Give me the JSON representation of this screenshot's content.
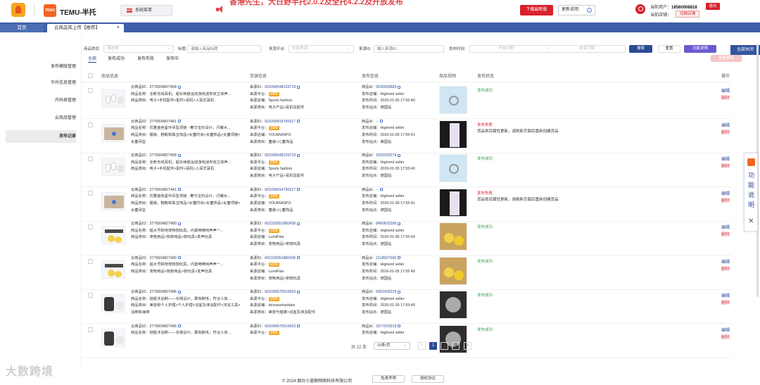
{
  "header": {
    "brand": "TEMU-半托",
    "sys_menu": "系统菜单",
    "announcement": "香港先生，大日野半托2.0.2及全托4.2.2及开放发布",
    "btn_download": "下载最新版",
    "btn_update": "更新说明",
    "user_label": "当前用户：",
    "user_phone": "18560008818",
    "store_label": "当前店铺：",
    "btn_logout": "退出",
    "btn_switch": "切换店铺"
  },
  "tabs": {
    "home": "首页",
    "active": "云商品库上传【推荐】",
    "close_icon": "×",
    "close_all": "全部关闭"
  },
  "sidebar": {
    "items": [
      "发布模版管理",
      "半托信息管理",
      "尺码表管理",
      "云商品管理",
      "发布记录"
    ],
    "active_index": 4
  },
  "filters": {
    "category_label": "商品类目",
    "category_placeholder": "请选择",
    "title_label": "标题",
    "title_placeholder": "请输入商品标题",
    "platform_label": "来源平台",
    "platform_placeholder": "全部来源",
    "source_id_label": "来源ID",
    "source_id_placeholder": "输入来源ID",
    "time_label": "发布时间",
    "start_placeholder": "开始日期",
    "dash": "-",
    "end_placeholder": "结束日期",
    "btn_search": "搜索",
    "btn_reset": "重置",
    "btn_help": "功能说明",
    "btn_batch_delete": "批量删除"
  },
  "status_tabs": [
    "全部",
    "发布成功",
    "发布失败",
    "发布中"
  ],
  "columns": [
    "商品信息",
    "货源信息",
    "发布信息",
    "商品视频",
    "发布状态",
    "操作"
  ],
  "rows": [
    {
      "cloud_id": "云商品ID：2776504827458",
      "name": "商品名称：全新无线耳机，超长续航运动游戏迷你双立体声...",
      "cat": "商品类目：电子>手机配件>配件>耳机>入耳式耳机",
      "src_id": "601099548120716",
      "src_platform": "来源平台：",
      "src_shop": "来源店铺：Sports fashion",
      "src_cat": "来源类目：电子产品>耳机及配件",
      "pub_id": "9536930683",
      "pub_shop": "发布店铺：Highend seller",
      "pub_time": "发布时间：2026-01-05 17:55:40",
      "pub_site": "发布站点：德国站",
      "status": "发布成功",
      "status_type": "ok",
      "msg": "",
      "thumb": "earbuds",
      "video": "light"
    },
    {
      "cloud_id": "云商品ID：2776504827441",
      "name": "商品名称：优雅蓝色星环吊坠项链 - 奢华宝石设计，闪耀水...",
      "cat": "商品类目：服装、鞋靴和珠宝饰品>女童时尚>女童饰品>女童项链>女童吊坠",
      "src_id": "601099914790117",
      "src_platform": "来源平台：",
      "src_shop": "来源店铺：YOUMIASPO",
      "src_cat": "来源类目：童装>儿童饰品",
      "pub_id": "--",
      "pub_shop": "发布店铺：Highend seller",
      "pub_time": "发布时间：2026-01-05 17:55:41",
      "pub_site": "发布站点：美国站",
      "status": "发布失败",
      "status_type": "fail",
      "msg": "货品类目属性更新，请刷新页面后重新创建货品",
      "thumb": "necklace",
      "video": "dark"
    },
    {
      "cloud_id": "云商品ID：2776504827458",
      "name": "商品名称：全新无线耳机，超长续航运动游戏迷你双立体声...",
      "cat": "商品类目：电子>手机配件>配件>耳机>入耳式耳机",
      "src_id": "601099548120716",
      "src_platform": "来源平台：",
      "src_shop": "来源店铺：Sports fashion",
      "src_cat": "来源类目：电子产品>耳机及配件",
      "pub_id": "1591930274",
      "pub_shop": "发布店铺：Highend seller",
      "pub_time": "发布时间：2026-01-05 17:55:40",
      "pub_site": "发布站点：德国站",
      "status": "发布成功",
      "status_type": "ok",
      "msg": "",
      "thumb": "earbuds",
      "video": "light"
    },
    {
      "cloud_id": "云商品ID：2776504827441",
      "name": "商品名称：优雅蓝色星环吊坠项链 - 奢华宝石设计，闪耀水...",
      "cat": "商品类目：服装、鞋靴和珠宝饰品>女童时尚>女童饰品>女童项链>女童吊坠",
      "src_id": "601099914790117",
      "src_platform": "来源平台：",
      "src_shop": "来源店铺：YOUMIASPO",
      "src_cat": "来源类目：童装>儿童饰品",
      "pub_id": "--",
      "pub_shop": "发布店铺：Highend seller",
      "pub_time": "发布时间：2026-01-05 17:55:41",
      "pub_site": "发布站点：德国站",
      "status": "发布失败",
      "status_type": "fail",
      "msg": "货品类目属性更新，请刷新页面后重新创建货品",
      "thumb": "necklace",
      "video": "dark"
    },
    {
      "cloud_id": "云商品ID：2776504827490",
      "name": "商品名称：超大号耐用宠物狗玩具，内置嘀嘀响声声一...",
      "cat": "商品类目：宠物用品>狗狗用品>狗玩具>发声玩具",
      "src_id": "601103051880428",
      "src_platform": "来源平台：",
      "src_shop": "来源店铺：LumiPaw",
      "src_cat": "来源类目：宠物用品>宠物玩具",
      "pub_id": "8490603395",
      "pub_shop": "发布店铺：Highend seller",
      "pub_time": "发布时间：2026-01-05 17:55:49",
      "pub_site": "发布站点：德国站",
      "status": "发布成功",
      "status_type": "ok",
      "msg": "",
      "thumb": "duck",
      "video": "duck"
    },
    {
      "cloud_id": "云商品ID：2776504827490",
      "name": "商品名称：超大号耐用宠物狗玩具，内置嘀嘀响声声一...",
      "cat": "商品类目：宠物用品>狗狗用品>狗玩具>发声玩具",
      "src_id": "601103051880428",
      "src_platform": "来源平台：",
      "src_shop": "来源店铺：LumiPaw",
      "src_cat": "来源类目：宠物用品>宠物玩具",
      "pub_id": "2118567558",
      "pub_shop": "发布店铺：Highend seller",
      "pub_time": "发布时间：2026-01-05 17:55:49",
      "pub_site": "发布站点：德国站",
      "status": "发布成功",
      "status_type": "ok",
      "msg": "",
      "thumb": "duck",
      "video": "duck"
    },
    {
      "cloud_id": "云商品ID：2776504827496",
      "name": "商品名称：硅胶沐浴刷——长柄设计，柔软刷毛，符合人体...",
      "cat": "商品类目：美容和个人护理>个人护理>浴室及淋浴配件>沐浴工具>浴刷和海绵",
      "src_id": "601099575610602",
      "src_platform": "来源平台：",
      "src_shop": "来源店铺：dexuearhaodain",
      "src_cat": "来源类目：美容与健康>浴室及淋浴配件",
      "pub_id": "5401436229",
      "pub_shop": "发布店铺：Highend seller",
      "pub_time": "发布时间：2026-01-05 17:55:49",
      "pub_site": "发布站点：德国站",
      "status": "发布成功",
      "status_type": "ok",
      "msg": "",
      "thumb": "brush",
      "video": "brush"
    },
    {
      "cloud_id": "云商品ID：2776504827496",
      "name": "商品名称：硅胶沐浴刷——长柄设计，柔软刷毛，符合人体...",
      "cat": "",
      "src_id": "601099575610602",
      "src_platform": "来源平台：",
      "src_shop": "",
      "src_cat": "",
      "pub_id": "3377529319",
      "pub_shop": "发布店铺：Highend seller",
      "pub_time": "",
      "pub_site": "",
      "status": "发布成功",
      "status_type": "ok",
      "msg": "",
      "thumb": "brush",
      "video": "brush"
    }
  ],
  "labels": {
    "src_id_label": "来源ID：",
    "pub_id_label": "商品id：",
    "platform_tag": "1688",
    "edit": "编辑",
    "delete": "删除"
  },
  "pagination": {
    "total": "共 22 条",
    "page_size": "10条/页",
    "pages": [
      "1",
      "2",
      "3"
    ],
    "current": "1",
    "prev": "‹",
    "next": "›"
  },
  "float_panel": {
    "text": "功能说明",
    "close": "✕"
  },
  "footer": {
    "copyright": "© 2024 烟台小蓝鲸网络科技有限公司",
    "disclaimer": "免责声明",
    "license": "授权协议"
  },
  "watermark": "大数跨境"
}
